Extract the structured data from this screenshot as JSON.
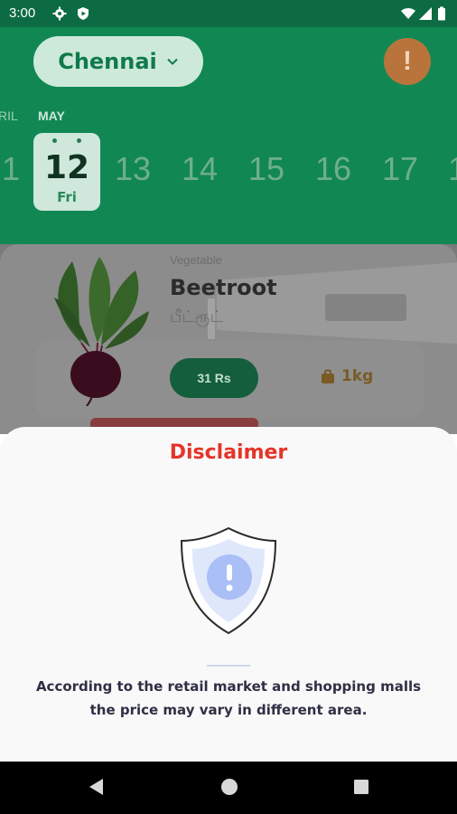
{
  "status_bar": {
    "time": "3:00",
    "icons": [
      "gear-icon",
      "play-protect-icon",
      "wifi-icon",
      "signal-icon",
      "battery-icon"
    ]
  },
  "header": {
    "city": "Chennai",
    "alert_icon": "!",
    "months": {
      "previous": "RIL",
      "current": "MAY"
    },
    "selected_date": {
      "day_number": "12",
      "weekday": "Fri"
    },
    "dates": [
      "1",
      "13",
      "14",
      "15",
      "16",
      "17",
      "1"
    ]
  },
  "product": {
    "category": "Vegetable",
    "name": "Beetroot",
    "local_name": "பீட்ரூட்",
    "price": "31 Rs",
    "weight": "1kg"
  },
  "disclaimer": {
    "title": "Disclaimer",
    "message": "According to the retail market and shopping malls the price may vary in different area."
  },
  "colors": {
    "header_green": "#118853",
    "disclaimer_red": "#e53429",
    "shield_blue": "#a9bff5"
  }
}
